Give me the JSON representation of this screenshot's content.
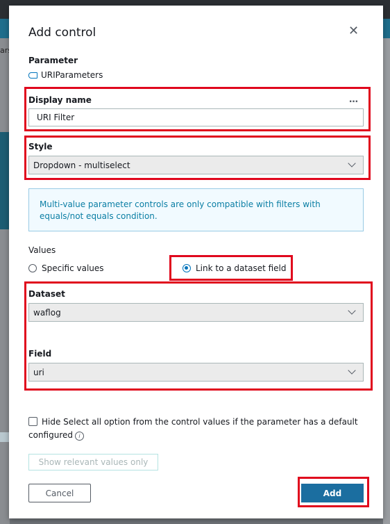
{
  "background": {
    "left_label": "ars"
  },
  "dialog": {
    "title": "Add control",
    "close_icon": "close-icon"
  },
  "parameter": {
    "label": "Parameter",
    "name": "URIParameters",
    "icon": "parameter-icon"
  },
  "display_name": {
    "label": "Display name",
    "more_label": "…",
    "value": "URI Filter"
  },
  "style": {
    "label": "Style",
    "value": "Dropdown - multiselect"
  },
  "info_message": "Multi-value parameter controls are only compatible with filters with equals/not equals condition.",
  "values": {
    "label": "Values",
    "options": [
      {
        "label": "Specific values",
        "selected": false
      },
      {
        "label": "Link to a dataset field",
        "selected": true
      }
    ]
  },
  "dataset": {
    "label": "Dataset",
    "value": "waflog"
  },
  "field": {
    "label": "Field",
    "value": "uri"
  },
  "hide_select_all": {
    "label": "Hide Select all option from the control values if the parameter has a default configured",
    "checked": false,
    "info_glyph": "i"
  },
  "buttons": {
    "show_relevant": "Show relevant values only",
    "cancel": "Cancel",
    "add": "Add"
  },
  "colors": {
    "highlight": "#e0081d",
    "primary": "#1b6ea0",
    "info_text": "#0a7ea4"
  }
}
